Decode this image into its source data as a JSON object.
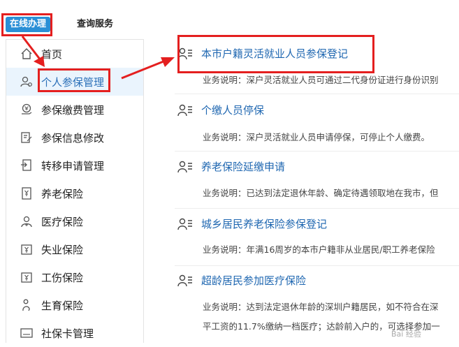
{
  "header": {
    "tab_active": "在线办理",
    "tab_query": "查询服务"
  },
  "sidebar": {
    "items": [
      {
        "label": "首页",
        "icon": "home-icon"
      },
      {
        "label": "个人参保管理",
        "icon": "person-gear-icon",
        "active": true
      },
      {
        "label": "参保缴费管理",
        "icon": "yuan-hand-icon"
      },
      {
        "label": "参保信息修改",
        "icon": "edit-doc-icon"
      },
      {
        "label": "转移申请管理",
        "icon": "transfer-icon"
      },
      {
        "label": "养老保险",
        "icon": "pension-doc-icon"
      },
      {
        "label": "医疗保险",
        "icon": "medical-person-icon"
      },
      {
        "label": "失业保险",
        "icon": "unemployment-icon"
      },
      {
        "label": "工伤保险",
        "icon": "injury-icon"
      },
      {
        "label": "生育保险",
        "icon": "maternity-icon"
      },
      {
        "label": "社保卡管理",
        "icon": "card-icon"
      }
    ]
  },
  "services": [
    {
      "title": "本市户籍灵活就业人员参保登记",
      "desc": "业务说明：深户灵活就业人员可通过二代身份证进行身份识别"
    },
    {
      "title": "个缴人员停保",
      "desc": "业务说明：深户灵活就业人员申请停保，可停止个人缴费。"
    },
    {
      "title": "养老保险延缴申请",
      "desc": "业务说明：已达到法定退休年龄、确定待遇领取地在我市，但"
    },
    {
      "title": "城乡居民养老保险参保登记",
      "desc": "业务说明：年满16周岁的本市户籍非从业居民/职工养老保险"
    },
    {
      "title": "超龄居民参加医疗保险",
      "desc": "业务说明：达到法定退休年龄的深圳户籍居民，如不符合在深",
      "desc2": "平工资的11.7%缴纳一档医疗；达龄前入户的，可选择参加一"
    }
  ],
  "colors": {
    "accent": "#2a8fd6",
    "link": "#1f67b1",
    "highlight": "#e41f1f"
  },
  "watermark": "Bai 经验"
}
